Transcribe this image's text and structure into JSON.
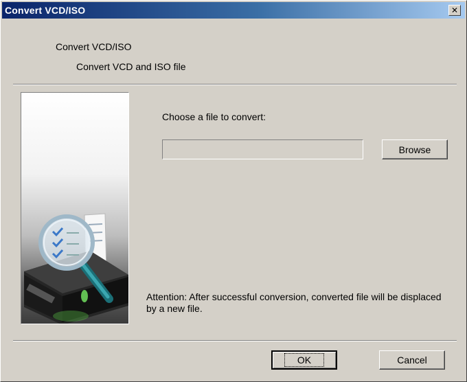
{
  "window": {
    "title": "Convert VCD/ISO",
    "close_glyph": "✕"
  },
  "header": {
    "title": "Convert VCD/ISO",
    "subtitle": "Convert VCD and ISO file"
  },
  "main": {
    "choose_label": "Choose a file to convert:",
    "file_value": "",
    "browse_label": "Browse",
    "attention": "Attention: After successful conversion, converted file will be displaced by a new file."
  },
  "footer": {
    "ok_label": "OK",
    "cancel_label": "Cancel"
  },
  "icons": {
    "side_image": "disc-drive-magnifier-icon"
  },
  "colors": {
    "title_start": "#0a246a",
    "title_end": "#a6caf0",
    "dialog_bg": "#d4d0c8"
  }
}
